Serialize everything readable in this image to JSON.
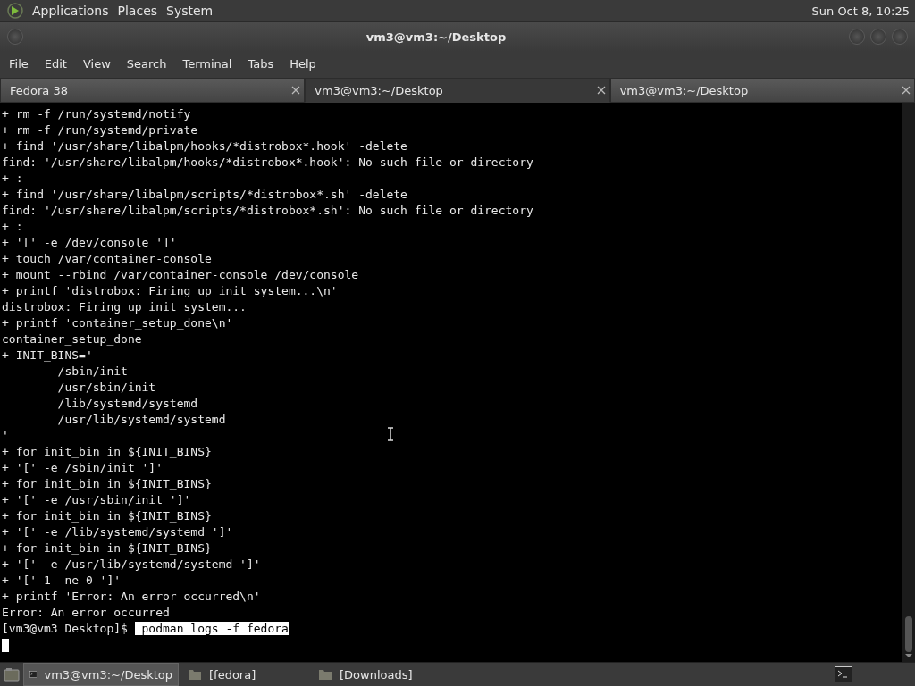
{
  "top_panel": {
    "menus": [
      "Applications",
      "Places",
      "System"
    ],
    "clock": "Sun Oct  8, 10:25"
  },
  "window": {
    "title": "vm3@vm3:~/Desktop"
  },
  "menu_bar": [
    "File",
    "Edit",
    "View",
    "Search",
    "Terminal",
    "Tabs",
    "Help"
  ],
  "tabs": [
    {
      "label": "Fedora 38",
      "selected": false
    },
    {
      "label": "vm3@vm3:~/Desktop",
      "selected": true
    },
    {
      "label": "vm3@vm3:~/Desktop",
      "selected": false
    }
  ],
  "terminal": {
    "lines": [
      {
        "kind": "output",
        "text": "+ rm -f /run/systemd/notify"
      },
      {
        "kind": "output",
        "text": "+ rm -f /run/systemd/private"
      },
      {
        "kind": "output",
        "text": "+ find '/usr/share/libalpm/hooks/*distrobox*.hook' -delete"
      },
      {
        "kind": "output",
        "text": "find: '/usr/share/libalpm/hooks/*distrobox*.hook': No such file or directory"
      },
      {
        "kind": "output",
        "text": "+ :"
      },
      {
        "kind": "output",
        "text": "+ find '/usr/share/libalpm/scripts/*distrobox*.sh' -delete"
      },
      {
        "kind": "output",
        "text": "find: '/usr/share/libalpm/scripts/*distrobox*.sh': No such file or directory"
      },
      {
        "kind": "output",
        "text": "+ :"
      },
      {
        "kind": "output",
        "text": "+ '[' -e /dev/console ']'"
      },
      {
        "kind": "output",
        "text": "+ touch /var/container-console"
      },
      {
        "kind": "output",
        "text": "+ mount --rbind /var/container-console /dev/console"
      },
      {
        "kind": "output",
        "text": "+ printf 'distrobox: Firing up init system...\\n'"
      },
      {
        "kind": "output",
        "text": "distrobox: Firing up init system..."
      },
      {
        "kind": "output",
        "text": "+ printf 'container_setup_done\\n'"
      },
      {
        "kind": "output",
        "text": "container_setup_done"
      },
      {
        "kind": "output",
        "text": "+ INIT_BINS='"
      },
      {
        "kind": "output",
        "text": "        /sbin/init"
      },
      {
        "kind": "output",
        "text": "        /usr/sbin/init"
      },
      {
        "kind": "output",
        "text": "        /lib/systemd/systemd"
      },
      {
        "kind": "output",
        "text": "        /usr/lib/systemd/systemd"
      },
      {
        "kind": "output",
        "text": "'"
      },
      {
        "kind": "output",
        "text": "+ for init_bin in ${INIT_BINS}"
      },
      {
        "kind": "output",
        "text": "+ '[' -e /sbin/init ']'"
      },
      {
        "kind": "output",
        "text": "+ for init_bin in ${INIT_BINS}"
      },
      {
        "kind": "output",
        "text": "+ '[' -e /usr/sbin/init ']'"
      },
      {
        "kind": "output",
        "text": "+ for init_bin in ${INIT_BINS}"
      },
      {
        "kind": "output",
        "text": "+ '[' -e /lib/systemd/systemd ']'"
      },
      {
        "kind": "output",
        "text": "+ for init_bin in ${INIT_BINS}"
      },
      {
        "kind": "output",
        "text": "+ '[' -e /usr/lib/systemd/systemd ']'"
      },
      {
        "kind": "output",
        "text": "+ '[' 1 -ne 0 ']'"
      },
      {
        "kind": "output",
        "text": "+ printf 'Error: An error occurred\\n'"
      },
      {
        "kind": "output",
        "text": "Error: An error occurred"
      },
      {
        "kind": "prompt",
        "prompt": "[vm3@vm3 Desktop]$",
        "command": " podman logs -f fedora"
      },
      {
        "kind": "cursor"
      }
    ]
  },
  "taskbar": {
    "tasks": [
      {
        "kind": "terminal",
        "label": "vm3@vm3:~/Desktop",
        "selected": true
      },
      {
        "kind": "folder",
        "label": "[fedora]",
        "selected": false
      },
      {
        "kind": "folder",
        "label": "[Downloads]",
        "selected": false
      }
    ]
  }
}
